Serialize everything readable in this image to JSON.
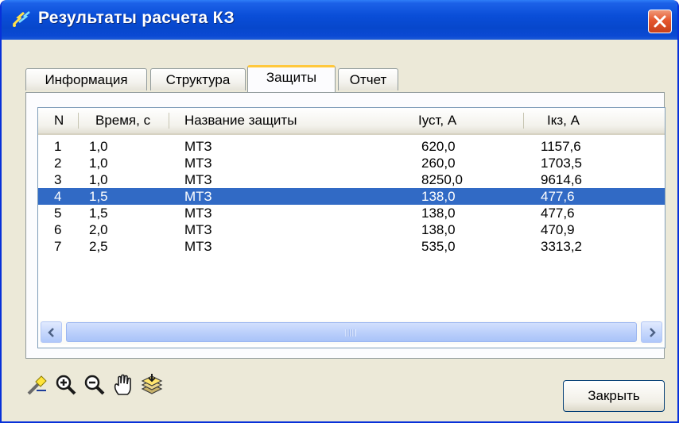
{
  "window": {
    "title": "Результаты расчета КЗ",
    "icon": "lightning-icon",
    "close_icon": "close-icon"
  },
  "tabs": [
    {
      "label": "Информация",
      "active": false
    },
    {
      "label": "Структура",
      "active": false
    },
    {
      "label": "Защиты",
      "active": true
    },
    {
      "label": "Отчет",
      "active": false
    }
  ],
  "table": {
    "columns": [
      "N",
      "Время, с",
      "Название защиты",
      "Iуст, А",
      "Iкз, А"
    ],
    "rows": [
      {
        "n": "1",
        "time": "1,0",
        "name": "МТЗ",
        "iust": "620,0",
        "ikz": "1157,6",
        "selected": false
      },
      {
        "n": "2",
        "time": "1,0",
        "name": "МТЗ",
        "iust": "260,0",
        "ikz": "1703,5",
        "selected": false
      },
      {
        "n": "3",
        "time": "1,0",
        "name": "МТЗ",
        "iust": "8250,0",
        "ikz": "9614,6",
        "selected": false
      },
      {
        "n": "4",
        "time": "1,5",
        "name": "МТЗ",
        "iust": "138,0",
        "ikz": "477,6",
        "selected": true
      },
      {
        "n": "5",
        "time": "1,5",
        "name": "МТЗ",
        "iust": "138,0",
        "ikz": "477,6",
        "selected": false
      },
      {
        "n": "6",
        "time": "2,0",
        "name": "МТЗ",
        "iust": "138,0",
        "ikz": "470,9",
        "selected": false
      },
      {
        "n": "7",
        "time": "2,5",
        "name": "МТЗ",
        "iust": "535,0",
        "ikz": "3313,2",
        "selected": false
      }
    ]
  },
  "toolbar": {
    "icons": [
      "highlight-icon",
      "zoom-in-icon",
      "zoom-out-icon",
      "pan-hand-icon",
      "layers-icon"
    ]
  },
  "buttons": {
    "close_label": "Закрыть"
  },
  "colors": {
    "titlebar": "#0a4ed8",
    "selection": "#316ac5",
    "active_tab_accent": "#ffc83c",
    "dialog_bg": "#ece9d8"
  }
}
